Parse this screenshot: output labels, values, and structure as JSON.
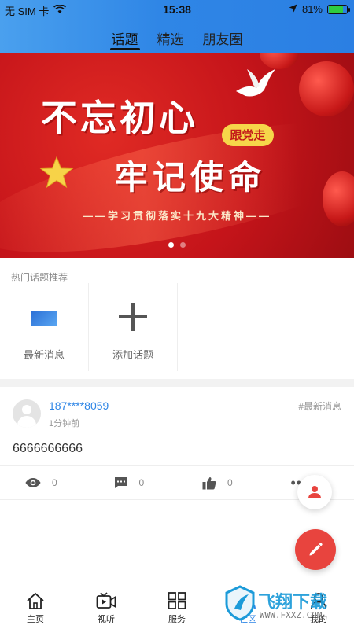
{
  "status_bar": {
    "carrier": "无 SIM 卡",
    "time": "15:38",
    "battery": "81%",
    "battery_level": 0.81
  },
  "top_tabs": [
    {
      "label": "话题",
      "active": true
    },
    {
      "label": "精选",
      "active": false
    },
    {
      "label": "朋友圈",
      "active": false
    }
  ],
  "banner": {
    "title_line1": "不忘初心",
    "title_line2": "牢记使命",
    "badge": "跟党走",
    "subtitle": "——学习贯彻落实十九大精神——",
    "slide_count": 2,
    "active_slide": 0
  },
  "hot_topics": {
    "title": "热门话题推荐",
    "items": [
      {
        "label": "最新消息",
        "icon": "news-thumbnail"
      },
      {
        "label": "添加话题",
        "icon": "plus-icon"
      }
    ]
  },
  "post": {
    "user": "187****8059",
    "time": "1分钟前",
    "tag": "#最新消息",
    "content": "6666666666",
    "views": "0",
    "comments": "0",
    "likes": "0"
  },
  "bottom_nav": [
    {
      "label": "主页",
      "icon": "home-icon",
      "active": false
    },
    {
      "label": "视听",
      "icon": "video-icon",
      "active": false
    },
    {
      "label": "服务",
      "icon": "grid-icon",
      "active": false
    },
    {
      "label": "社区",
      "icon": "community-icon",
      "active": true
    },
    {
      "label": "我的",
      "icon": "profile-icon",
      "active": false
    }
  ],
  "watermark": {
    "text": "飞翔下载",
    "url": "WWW.FXXZ.COM"
  },
  "colors": {
    "accent": "#2f86e6",
    "banner_red": "#c5141a",
    "fab_red": "#e8443e"
  }
}
